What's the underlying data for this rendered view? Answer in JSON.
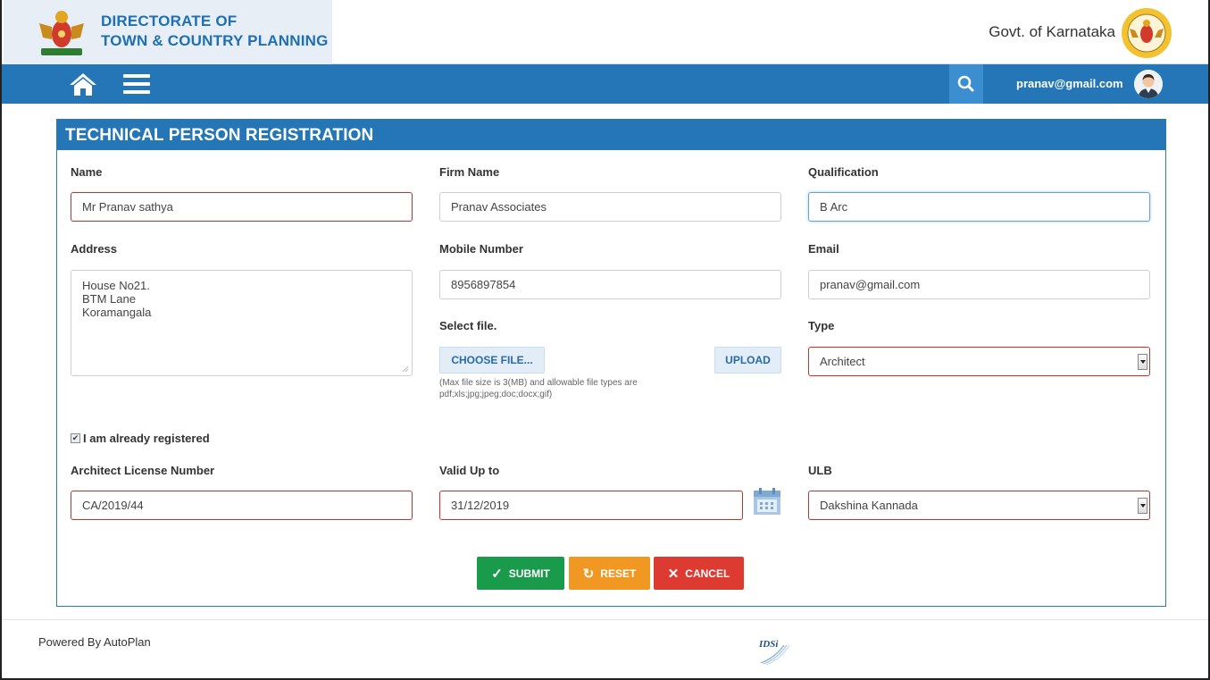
{
  "header": {
    "org_line1": "DIRECTORATE OF",
    "org_line2": "TOWN & COUNTRY PLANNING",
    "govt": "Govt. of Karnataka"
  },
  "navbar": {
    "user_email": "pranav@gmail.com"
  },
  "form": {
    "title": "TECHNICAL PERSON REGISTRATION",
    "name_label": "Name",
    "name_value": "Mr Pranav sathya",
    "firm_label": "Firm Name",
    "firm_value": "Pranav Associates",
    "qual_label": "Qualification",
    "qual_value": "B Arc",
    "address_label": "Address",
    "address_lines": [
      "House No21.",
      "BTM Lane",
      "Koramangala"
    ],
    "mobile_label": "Mobile Number",
    "mobile_value": "8956897854",
    "email_label": "Email",
    "email_value": "pranav@gmail.com",
    "select_file_label": "Select file.",
    "choose_file": "CHOOSE FILE...",
    "upload": "UPLOAD",
    "file_hint_1": "(Max file size is 3(MB) and allowable file types are",
    "file_hint_2": "pdf;xls;jpg;jpeg;doc;docx;gif)",
    "type_label": "Type",
    "type_value": "Architect",
    "registered_label": "I am already registered",
    "registered_checked": true,
    "license_label": "Architect License Number",
    "license_value": "CA/2019/44",
    "valid_label": "Valid Up to",
    "valid_value": "31/12/2019",
    "ulb_label": "ULB",
    "ulb_value": "Dakshina Kannada"
  },
  "actions": {
    "submit": "SUBMIT",
    "reset": "RESET",
    "cancel": "CANCEL"
  },
  "footer": {
    "powered_by": "Powered By AutoPlan",
    "partner_logo_text": "IDSi"
  },
  "colors": {
    "primary": "#2476b7",
    "submit": "#1a9a4b",
    "reset": "#f19822",
    "cancel": "#dd3b32",
    "error_border": "#c9302c"
  },
  "icons": [
    "karnataka-emblem-icon",
    "govt-seal-icon",
    "home-icon",
    "menu-icon",
    "search-icon",
    "avatar-icon",
    "calendar-icon",
    "check-icon",
    "refresh-icon",
    "close-icon"
  ]
}
